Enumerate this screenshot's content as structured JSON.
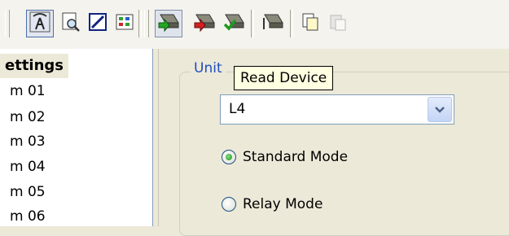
{
  "tree": {
    "header": "ettings",
    "items": [
      "m 01",
      "m 02",
      "m 03",
      "m 04",
      "m 05",
      "m 06"
    ]
  },
  "group": {
    "legend": "Unit",
    "combo_value": "L4"
  },
  "tooltip": "Read Device",
  "modes": {
    "standard": "Standard Mode",
    "relay": "Relay Mode",
    "selected": "standard"
  },
  "toolbar": {
    "icons": [
      "antenna-icon",
      "print-preview-icon",
      "edit-icon",
      "palette-icon",
      "read-device-icon",
      "write-device-icon",
      "verify-device-icon",
      "send-device-icon",
      "copy-icon",
      "paste-icon"
    ]
  },
  "colors": {
    "accent": "#1f4fbf",
    "tooltip_bg": "#ffffe1",
    "window_bg": "#ece9d8"
  }
}
